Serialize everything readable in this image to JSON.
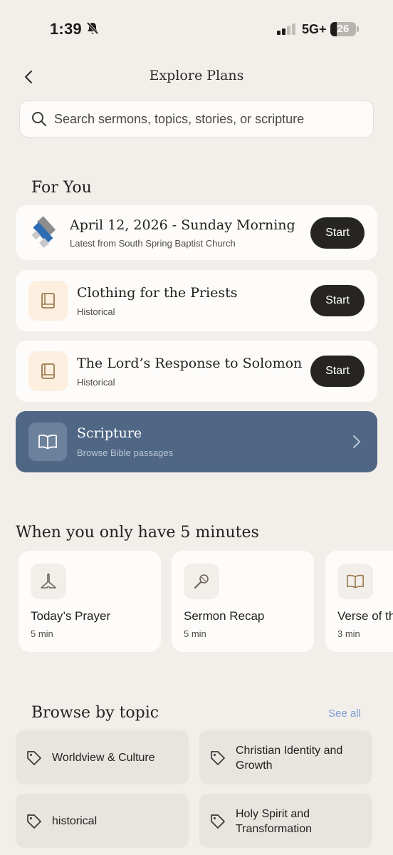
{
  "status_bar": {
    "time": "1:39",
    "network": "5G+",
    "battery": "26",
    "battery_level": 0.26
  },
  "header": {
    "title": "Explore Plans",
    "back_icon": "chevron-left-icon"
  },
  "search": {
    "placeholder": "Search sermons, topics, stories, or scripture",
    "value": ""
  },
  "for_you": {
    "title": "For You",
    "cards": [
      {
        "title": "April 12, 2026 - Sunday Morning",
        "subtitle": "Latest from South Spring Baptist Church",
        "button": "Start",
        "icon": "church-logo"
      },
      {
        "title": "Clothing for the Priests",
        "subtitle": "Historical",
        "button": "Start",
        "icon": "book-icon"
      },
      {
        "title": "The Lord’s Response to Solomon",
        "subtitle": "Historical",
        "button": "Start",
        "icon": "book-icon"
      }
    ],
    "scripture": {
      "title": "Scripture",
      "subtitle": "Browse Bible passages",
      "icon": "open-book-icon"
    }
  },
  "five_minutes": {
    "title": "When you only have 5 minutes",
    "items": [
      {
        "title": "Today’s Prayer",
        "duration": "5 min",
        "icon": "praying-hands-icon"
      },
      {
        "title": "Sermon Recap",
        "duration": "5 min",
        "icon": "microphone-icon"
      },
      {
        "title": "Verse of th",
        "duration": "3 min",
        "icon": "open-book-icon"
      }
    ]
  },
  "topics": {
    "title": "Browse by topic",
    "see_all": "See all",
    "items": [
      {
        "label": "Worldview & Culture",
        "icon": "tag-icon"
      },
      {
        "label": "Christian Identity and Growth",
        "icon": "tag-icon"
      },
      {
        "label": "historical",
        "icon": "tag-icon"
      },
      {
        "label": "Holy Spirit and Transformation",
        "icon": "tag-icon"
      }
    ]
  },
  "colors": {
    "background": "#f2efeb",
    "accent_blue": "#4f6785",
    "button_dark": "#272522",
    "link": "#7e9fd3"
  }
}
